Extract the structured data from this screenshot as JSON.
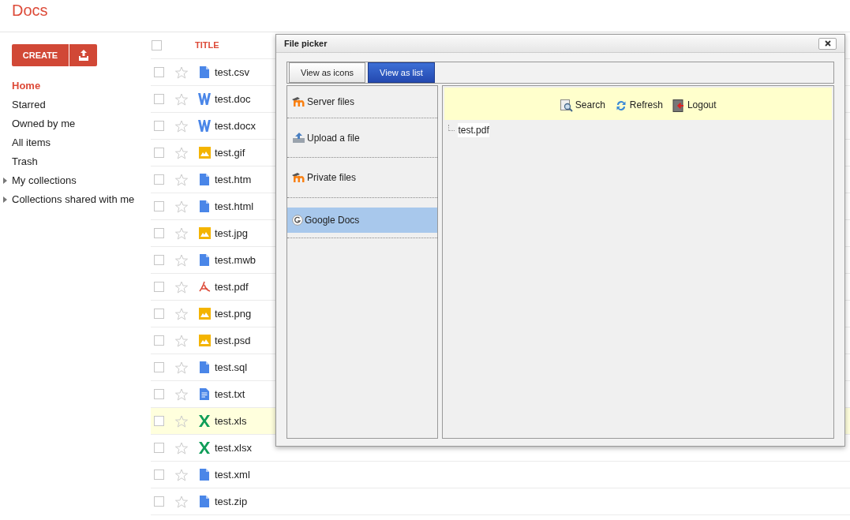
{
  "app": {
    "title": "Docs"
  },
  "sidebar": {
    "create_button": "CREATE",
    "items": [
      {
        "label": "Home",
        "selected": true,
        "kind": "link"
      },
      {
        "label": "Starred",
        "selected": false,
        "kind": "link"
      },
      {
        "label": "Owned by me",
        "selected": false,
        "kind": "link"
      },
      {
        "label": "All items",
        "selected": false,
        "kind": "link"
      },
      {
        "label": "Trash",
        "selected": false,
        "kind": "link"
      },
      {
        "label": "My collections",
        "selected": false,
        "kind": "collapsible"
      },
      {
        "label": "Collections shared with me",
        "selected": false,
        "kind": "collapsible"
      }
    ]
  },
  "file_list": {
    "select_all_checked": false,
    "title_column": "TITLE",
    "rows": [
      {
        "name": "test.csv",
        "kind": "doc",
        "selected": false
      },
      {
        "name": "test.doc",
        "kind": "word",
        "selected": false
      },
      {
        "name": "test.docx",
        "kind": "word",
        "selected": false
      },
      {
        "name": "test.gif",
        "kind": "image",
        "selected": false
      },
      {
        "name": "test.htm",
        "kind": "doc",
        "selected": false
      },
      {
        "name": "test.html",
        "kind": "doc",
        "selected": false
      },
      {
        "name": "test.jpg",
        "kind": "image",
        "selected": false
      },
      {
        "name": "test.mwb",
        "kind": "doc",
        "selected": false
      },
      {
        "name": "test.pdf",
        "kind": "pdf",
        "selected": false
      },
      {
        "name": "test.png",
        "kind": "image",
        "selected": false
      },
      {
        "name": "test.psd",
        "kind": "image",
        "selected": false
      },
      {
        "name": "test.sql",
        "kind": "doc",
        "selected": false
      },
      {
        "name": "test.txt",
        "kind": "text",
        "selected": false
      },
      {
        "name": "test.xls",
        "kind": "excel",
        "selected": true
      },
      {
        "name": "test.xlsx",
        "kind": "excel",
        "selected": false
      },
      {
        "name": "test.xml",
        "kind": "doc",
        "selected": false
      },
      {
        "name": "test.zip",
        "kind": "doc",
        "selected": false
      }
    ]
  },
  "dialog": {
    "title": "File picker",
    "tabs": [
      {
        "label": "View as icons",
        "selected": false
      },
      {
        "label": "View as list",
        "selected": true
      }
    ],
    "sources": [
      {
        "label": "Server files",
        "kind": "moodle",
        "selected": false
      },
      {
        "label": "Upload a file",
        "kind": "upload",
        "selected": false
      },
      {
        "label": "Private files",
        "kind": "moodle",
        "selected": false
      },
      {
        "label": "Google Docs",
        "kind": "google",
        "selected": true
      }
    ],
    "toolbar": [
      {
        "label": "Search",
        "kind": "search"
      },
      {
        "label": "Refresh",
        "kind": "refresh"
      },
      {
        "label": "Logout",
        "kind": "logout"
      }
    ],
    "files": [
      "test.pdf"
    ]
  }
}
